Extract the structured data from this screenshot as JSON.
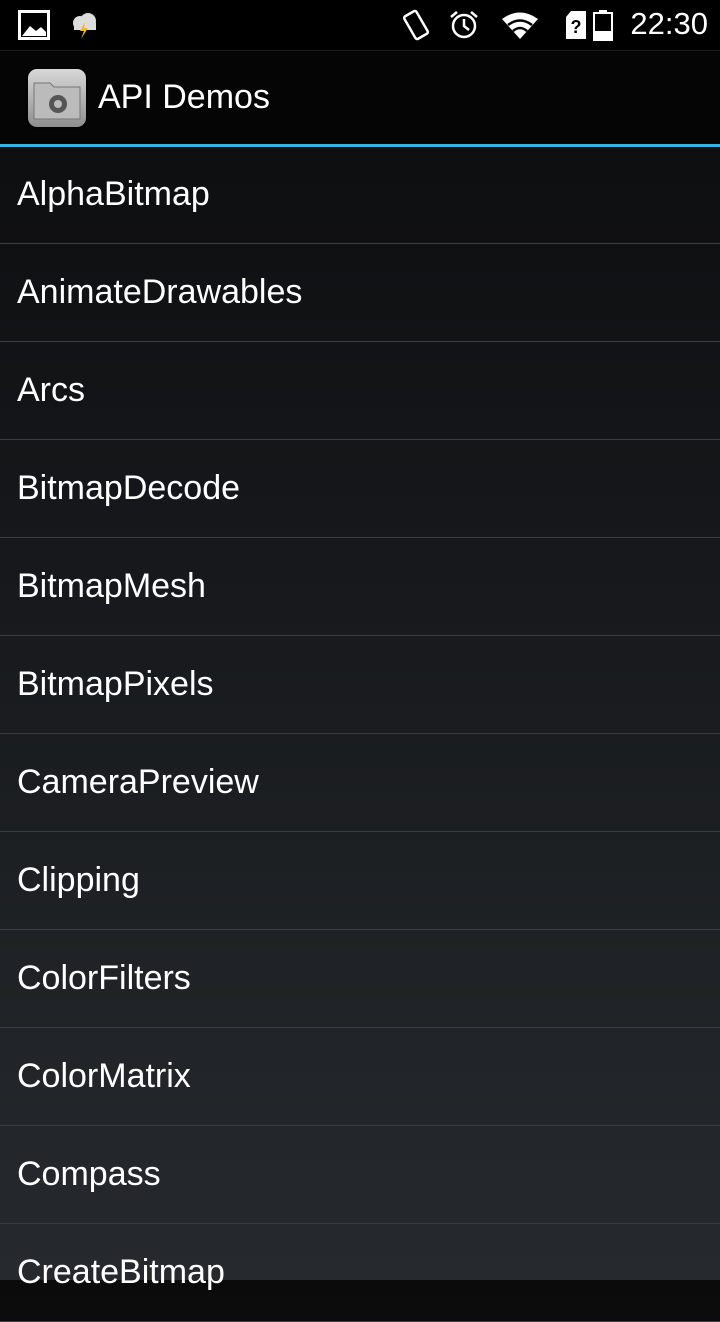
{
  "status_bar": {
    "time": "22:30",
    "icons": [
      "image-notification-icon",
      "weather-storm-icon",
      "vibrate-icon",
      "alarm-icon",
      "wifi-icon",
      "sim-unknown-icon",
      "battery-icon"
    ]
  },
  "action_bar": {
    "title": "API Demos",
    "icon": "api-demos-folder-gear-icon"
  },
  "accent_color": "#33b5e5",
  "list": {
    "items": [
      "AlphaBitmap",
      "AnimateDrawables",
      "Arcs",
      "BitmapDecode",
      "BitmapMesh",
      "BitmapPixels",
      "CameraPreview",
      "Clipping",
      "ColorFilters",
      "ColorMatrix",
      "Compass",
      "CreateBitmap"
    ]
  }
}
